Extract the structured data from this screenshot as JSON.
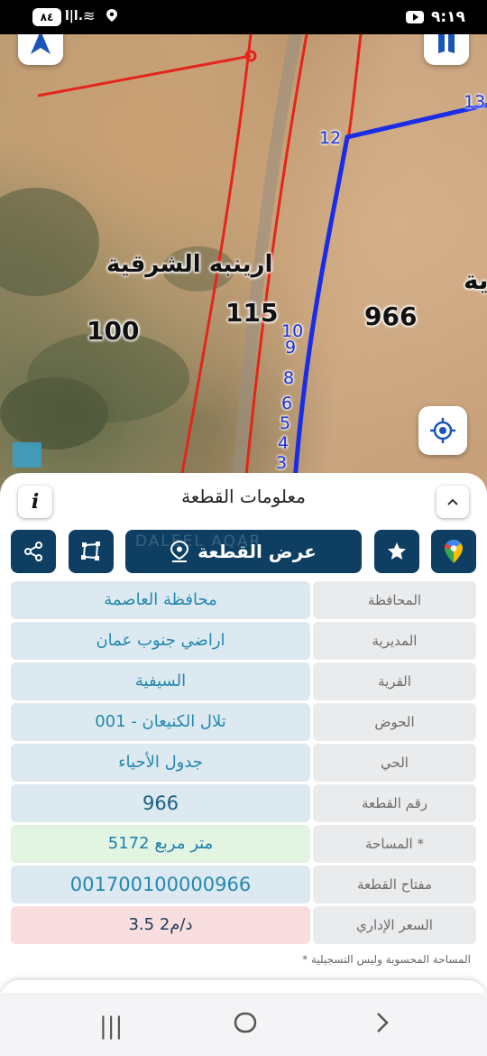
{
  "status_bar": {
    "time": "٩:١٩",
    "battery": "٨٤"
  },
  "map": {
    "labels": {
      "village_name": "ارينبه الشرقية",
      "parcel_100": "100",
      "parcel_115": "115",
      "parcel_966": "966",
      "edge_partial": "ية"
    },
    "segment_numbers": [
      "13",
      "12",
      "10",
      "9",
      "8",
      "6",
      "5",
      "4",
      "3"
    ],
    "colors": {
      "parcel_boundary": "#e5241b",
      "selected_parcel": "#1a2ce6"
    }
  },
  "panel": {
    "title": "معلومات القطعة",
    "info_label": "i",
    "show_plot_label": "عرض القطعة",
    "watermark": "DALEEL AQAR",
    "rows": [
      {
        "label": "المحافظة",
        "value": "محافظة العاصمة"
      },
      {
        "label": "المديرية",
        "value": "اراضي جنوب عمان"
      },
      {
        "label": "القرية",
        "value": "السيفية"
      },
      {
        "label": "الحوض",
        "value": "تلال الكنيعان - 001"
      },
      {
        "label": "الحي",
        "value": "جدول الأحياء"
      },
      {
        "label": "رقم القطعة",
        "value": "966"
      },
      {
        "label": "المساحة *",
        "value": "5172 متر مربع"
      },
      {
        "label": "مفتاح القطعة",
        "value": "001700100000966"
      },
      {
        "label": "السعر الإداري",
        "value": "3.5 د/م2"
      }
    ],
    "footnote": "* المساحة المحسوبة وليس التسجيلية"
  },
  "colors": {
    "primary": "#0e3f63",
    "value_text": "#2388b0"
  }
}
